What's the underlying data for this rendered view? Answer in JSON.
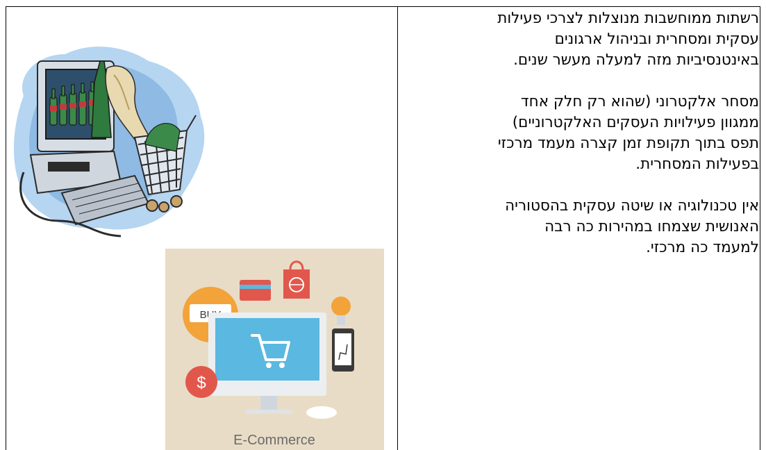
{
  "paragraphs": [
    {
      "lines": [
        "רשתות ממוחשבות מנוצלות לצרכי פעילות",
        "עסקית ומסחרית ובניהול ארגונים",
        "באינטנסיביות מזה למעלה מעשר שנים."
      ]
    },
    {
      "lines": [
        "מסחר אלקטרוני (שהוא רק חלק אחד",
        "ממגוון פעילויות העסקים האלקטרוניים)",
        "תפס בתוך תקופת זמן קצרה מעמד מרכזי",
        "בפעילות המסחרית."
      ]
    },
    {
      "lines": [
        "אין טכנולוגיה או שיטה עסקית בהסטוריה",
        "האנושית שצמחו במהירות כה רבה",
        "למעמד כה מרכזי."
      ]
    }
  ],
  "ecommerce_image": {
    "buy_label": "BUY",
    "dollar_sign": "$",
    "caption": "E-Commerce",
    "colors": {
      "bg": "#e9dcc6",
      "orange": "#f2a33a",
      "red": "#e2574c",
      "screen": "#5bb8e0",
      "monitor": "#eceff1"
    }
  }
}
